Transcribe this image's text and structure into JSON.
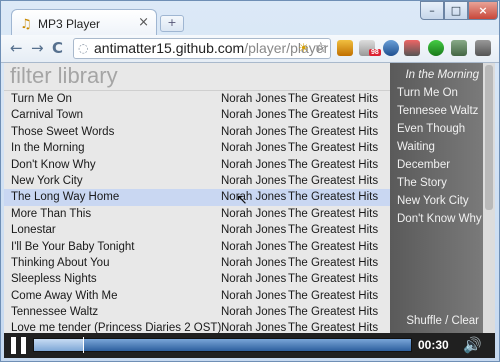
{
  "browser": {
    "tab_title": "MP3 Player",
    "tab_close": "×",
    "new_tab": "+",
    "window_min": "–",
    "window_max": "□",
    "window_close": "×",
    "back": "←",
    "forward": "→",
    "reload": "C",
    "url_host": "antimatter15.github.com",
    "url_path": "/player/player",
    "ext_badge": "98"
  },
  "filter": {
    "placeholder": "filter library"
  },
  "songs": [
    {
      "title": "Turn Me On",
      "artist": "Norah Jones",
      "album": "The Greatest Hits"
    },
    {
      "title": "Carnival Town",
      "artist": "Norah Jones",
      "album": "The Greatest Hits"
    },
    {
      "title": "Those Sweet Words",
      "artist": "Norah Jones",
      "album": "The Greatest Hits"
    },
    {
      "title": "In the Morning",
      "artist": "Norah Jones",
      "album": "The Greatest Hits"
    },
    {
      "title": "Don't Know Why",
      "artist": "Norah Jones",
      "album": "The Greatest Hits"
    },
    {
      "title": "New York City",
      "artist": "Norah Jones",
      "album": "The Greatest Hits"
    },
    {
      "title": "The Long Way Home",
      "artist": "Norah Jones",
      "album": "The Greatest Hits",
      "selected": true
    },
    {
      "title": "More Than This",
      "artist": "Norah Jones",
      "album": "The Greatest Hits"
    },
    {
      "title": "Lonestar",
      "artist": "Norah Jones",
      "album": "The Greatest Hits"
    },
    {
      "title": "I'll Be Your Baby Tonight",
      "artist": "Norah Jones",
      "album": "The Greatest Hits"
    },
    {
      "title": "Thinking About You",
      "artist": "Norah Jones",
      "album": "The Greatest Hits"
    },
    {
      "title": "Sleepless Nights",
      "artist": "Norah Jones",
      "album": "The Greatest Hits"
    },
    {
      "title": "Come Away With Me",
      "artist": "Norah Jones",
      "album": "The Greatest Hits"
    },
    {
      "title": "Tennessee Waltz",
      "artist": "Norah Jones",
      "album": "The Greatest Hits"
    },
    {
      "title": "Love me tender (Princess Diaries 2 OST)",
      "artist": "Norah Jones",
      "album": "The Greatest Hits"
    }
  ],
  "queue": {
    "now_playing": "In the Morning",
    "items": [
      "Turn Me On",
      "Tennesee Waltz",
      "Even Though",
      "Waiting",
      "December",
      "The Story",
      "New York City",
      "Don't Know Why"
    ],
    "shuffle_label": "Shuffle",
    "separator": " / ",
    "clear_label": "Clear"
  },
  "player": {
    "time": "00:30",
    "progress_fraction": 0.13,
    "state": "playing"
  },
  "colors": {
    "accent": "#2d5f9e",
    "selected_row": "#c9d7f2"
  }
}
